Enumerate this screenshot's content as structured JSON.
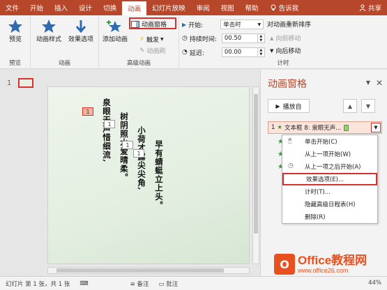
{
  "tabs": [
    "文件",
    "开始",
    "插入",
    "设计",
    "切换",
    "动画",
    "幻灯片放映",
    "审阅",
    "视图",
    "帮助",
    "告诉我",
    "共享"
  ],
  "active_tab": "动画",
  "ribbon": {
    "preview": {
      "label": "预览",
      "group": "预览"
    },
    "animation": {
      "style_label": "动画样式",
      "effect_label": "效果选项",
      "group": "动画"
    },
    "advanced": {
      "add_label": "添加动画",
      "pane_label": "动画窗格",
      "trigger_label": "触发",
      "painter_label": "动画刷",
      "group": "高级动画"
    },
    "timing": {
      "start_label": "开始:",
      "start_value": "单击时",
      "duration_label": "持续时间:",
      "duration_value": "00.50",
      "delay_label": "延迟:",
      "delay_value": "00.00",
      "reorder_label": "对动画重新排序",
      "forward_label": "向前移动",
      "backward_label": "向后移动",
      "group": "计时"
    }
  },
  "thumbs": {
    "slide_number": "1"
  },
  "slide": {
    "poem_lines": [
      "泉眼无声惜细流,",
      "树阴照水爱晴柔。",
      "小荷才露尖尖角,",
      "早有蜻蜓立上头。"
    ],
    "tags": [
      "1",
      "1",
      "1",
      "1"
    ]
  },
  "pane": {
    "title": "动画窗格",
    "play_label": "播放自",
    "item": {
      "number": "1",
      "label": "文本框 8: 泉眼无声..."
    },
    "menu": [
      {
        "label": "单击开始(C)",
        "icon": "mouse-icon"
      },
      {
        "label": "从上一项开始(W)",
        "icon": ""
      },
      {
        "label": "从上一项之后开始(A)",
        "icon": "clock-icon"
      },
      {
        "label": "效果选项(E)...",
        "icon": ""
      },
      {
        "label": "计时(T)...",
        "icon": ""
      },
      {
        "label": "隐藏高级日程表(H)",
        "icon": ""
      },
      {
        "label": "删除(R)",
        "icon": ""
      }
    ]
  },
  "status": {
    "slide_info": "幻灯片 第 1 张，共 1 张",
    "notes": "备注",
    "comments": "批注",
    "zoom": "44%"
  },
  "watermark": {
    "brand": "Office教程网",
    "url": "www.office26.com",
    "logo_letter": "O"
  },
  "colors": {
    "accent": "#b7472a",
    "highlight": "#d9302b",
    "star": "#3c9a3c"
  }
}
